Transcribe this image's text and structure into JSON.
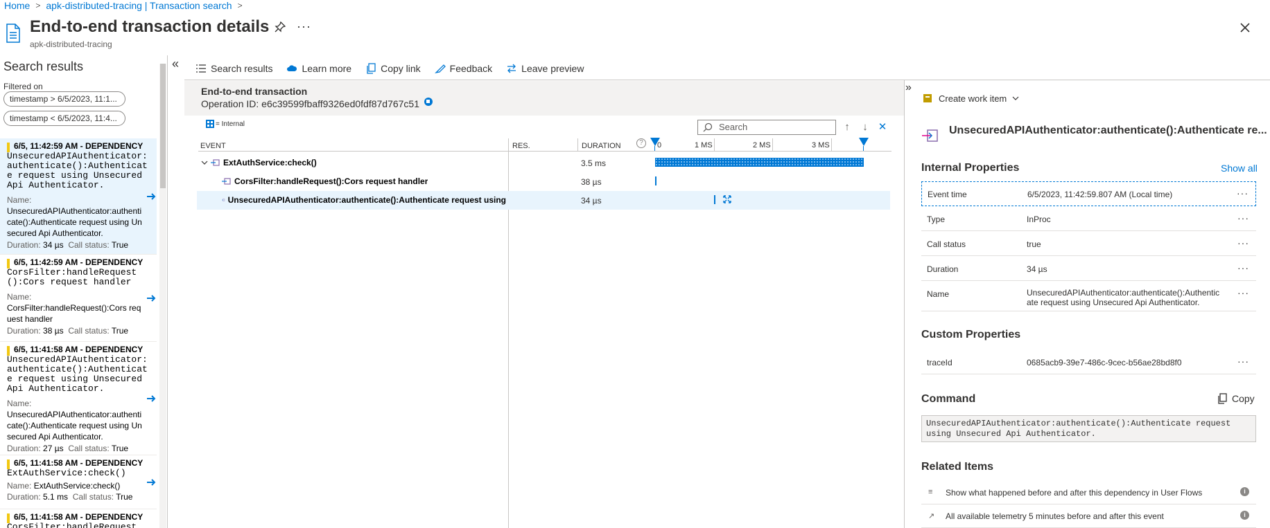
{
  "breadcrumb": {
    "home": "Home",
    "parent": "apk-distributed-tracing | Transaction search"
  },
  "header": {
    "title": "End-to-end transaction details",
    "subtitle": "apk-distributed-tracing",
    "more": "···"
  },
  "left": {
    "title": "Search results",
    "filtered_on": "Filtered on",
    "filters": [
      "timestamp > 6/5/2023, 11:1...",
      "timestamp < 6/5/2023, 11:4..."
    ],
    "results": [
      {
        "head": "6/5, 11:42:59 AM - DEPENDENCY",
        "cmd": "UnsecuredAPIAuthenticator:authenticate():Authenticate request using Unsecured Api Authenticator.",
        "name_label": "Name:",
        "name": "UnsecuredAPIAuthenticator:authenticate():Authenticate request using Unsecured Api Authenticator.",
        "duration_label": "Duration:",
        "duration": "34 µs",
        "status_label": "Call status:",
        "status": "True"
      },
      {
        "head": "6/5, 11:42:59 AM - DEPENDENCY",
        "cmd": "CorsFilter:handleRequest():Cors request handler",
        "name_label": "Name:",
        "name": "CorsFilter:handleRequest():Cors request handler",
        "duration_label": "Duration:",
        "duration": "38 µs",
        "status_label": "Call status:",
        "status": "True"
      },
      {
        "head": "6/5, 11:41:58 AM - DEPENDENCY",
        "cmd": "UnsecuredAPIAuthenticator:authenticate():Authenticate request using Unsecured Api Authenticator.",
        "name_label": "Name:",
        "name": "UnsecuredAPIAuthenticator:authenticate():Authenticate request using Unsecured Api Authenticator.",
        "duration_label": "Duration:",
        "duration": "27 µs",
        "status_label": "Call status:",
        "status": "True"
      },
      {
        "head": "6/5, 11:41:58 AM - DEPENDENCY",
        "cmd": "ExtAuthService:check()",
        "name_label": "Name:",
        "name": "ExtAuthService:check()",
        "duration_label": "Duration:",
        "duration": "5.1 ms",
        "status_label": "Call status:",
        "status": "True"
      },
      {
        "head": "6/5, 11:41:58 AM - DEPENDENCY",
        "cmd": "CorsFilter:handleRequest():Co",
        "name_label": "",
        "name": "",
        "duration_label": "",
        "duration": "",
        "status_label": "",
        "status": ""
      }
    ]
  },
  "toolbar": {
    "search_results": "Search results",
    "learn_more": "Learn more",
    "copy_link": "Copy link",
    "feedback": "Feedback",
    "leave_preview": "Leave preview"
  },
  "transaction": {
    "title": "End-to-end transaction",
    "operation_id": "Operation ID: e6c39599fbaff9326ed0fdf87d767c51",
    "legend": "= Internal",
    "search_placeholder": "Search",
    "columns": {
      "event": "EVENT",
      "res": "RES.",
      "duration": "DURATION"
    },
    "ticks": [
      "0",
      "1 MS",
      "2 MS",
      "3 MS"
    ],
    "rows": [
      {
        "event": "ExtAuthService:check()",
        "duration": "3.5 ms"
      },
      {
        "event": "CorsFilter:handleRequest():Cors request handler",
        "duration": "38 µs"
      },
      {
        "event": "UnsecuredAPIAuthenticator:authenticate():Authenticate request using",
        "duration": "34 µs"
      }
    ]
  },
  "details": {
    "create_work_item": "Create work item",
    "heading": "UnsecuredAPIAuthenticator:authenticate():Authenticate re...",
    "internal_title": "Internal Properties",
    "show_all": "Show all",
    "internal": [
      {
        "key": "Event time",
        "value": "6/5/2023, 11:42:59.807 AM (Local time)"
      },
      {
        "key": "Type",
        "value": "InProc"
      },
      {
        "key": "Call status",
        "value": "true"
      },
      {
        "key": "Duration",
        "value": "34 µs"
      },
      {
        "key": "Name",
        "value": "UnsecuredAPIAuthenticator:authenticate():Authenticate request using Unsecured Api Authenticator."
      }
    ],
    "custom_title": "Custom Properties",
    "custom": [
      {
        "key": "traceId",
        "value": "0685acb9-39e7-486c-9cec-b56ae28bd8f0"
      }
    ],
    "command_title": "Command",
    "copy": "Copy",
    "command": "UnsecuredAPIAuthenticator:authenticate():Authenticate request using Unsecured Api Authenticator.",
    "related_title": "Related Items",
    "related": [
      {
        "text": "Show what happened before and after this dependency in User Flows"
      },
      {
        "text": "All available telemetry 5 minutes before and after this event"
      }
    ],
    "more": "···"
  },
  "colors": {
    "accent": "#0078d4",
    "bar": "#f2c811"
  }
}
